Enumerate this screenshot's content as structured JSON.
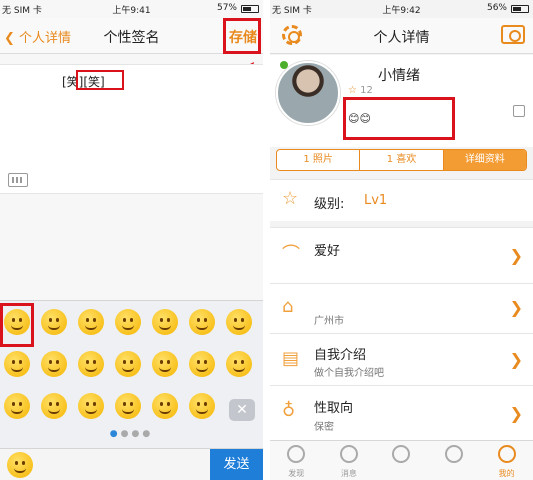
{
  "left": {
    "status": {
      "carrier": "无 SIM 卡",
      "time": "上午9:41",
      "battery": "57%",
      "battery_level": 0.57
    },
    "nav": {
      "back_label": "个人详情",
      "title": "个性签名",
      "save_label": "存储"
    },
    "signature": {
      "text": "[笑][笑]"
    },
    "emoji_rows": [
      [
        "smile",
        "grin",
        "tongue",
        "grimace",
        "wink",
        "relieved",
        "neutral"
      ],
      [
        "smirk",
        "wink-smile",
        "heart-eyes",
        "kiss",
        "flushed",
        "sad",
        "disappointed"
      ],
      [
        "angry",
        "dizzy",
        "mask",
        "astonished",
        "sweat",
        "scream",
        "backspace"
      ]
    ],
    "page_indicator": {
      "pages": 4,
      "current": 1
    },
    "send_label": "发送"
  },
  "right": {
    "status": {
      "carrier": "无 SIM 卡",
      "time": "上午9:42",
      "battery": "56%",
      "battery_level": 0.56
    },
    "nav": {
      "title": "个人详情"
    },
    "profile": {
      "nickname": "小情绪",
      "stars": "12",
      "signature": "😊😊"
    },
    "tabs": [
      "1 照片",
      "1 喜欢",
      "详细资料"
    ],
    "active_tab": "详细资料",
    "rows": {
      "level": {
        "label": "级别:",
        "value": "Lv1"
      },
      "hobby": {
        "label": "爱好"
      },
      "location": {
        "sub": "广州市"
      },
      "intro": {
        "label": "自我介绍",
        "sub": "做个自我介绍吧"
      },
      "orientation": {
        "label": "性取向",
        "sub": "保密"
      }
    },
    "tabbar": [
      "发现",
      "消息",
      "",
      "",
      "我的"
    ],
    "active_tabbar": "我的"
  },
  "colors": {
    "accent": "#e98a1f",
    "highlight": "#d9121b",
    "send": "#1f7ed8"
  }
}
